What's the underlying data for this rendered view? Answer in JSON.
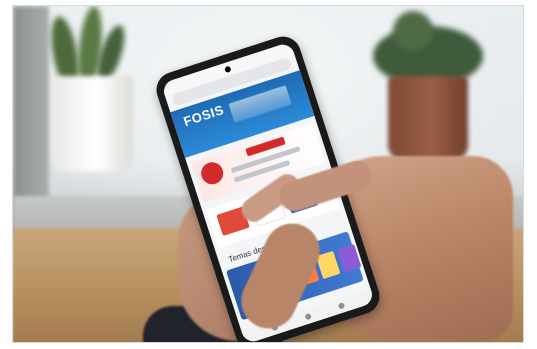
{
  "photo": {
    "phone_screen": {
      "site_logo": "FOSIS",
      "section_title": "Temas destacados"
    }
  }
}
